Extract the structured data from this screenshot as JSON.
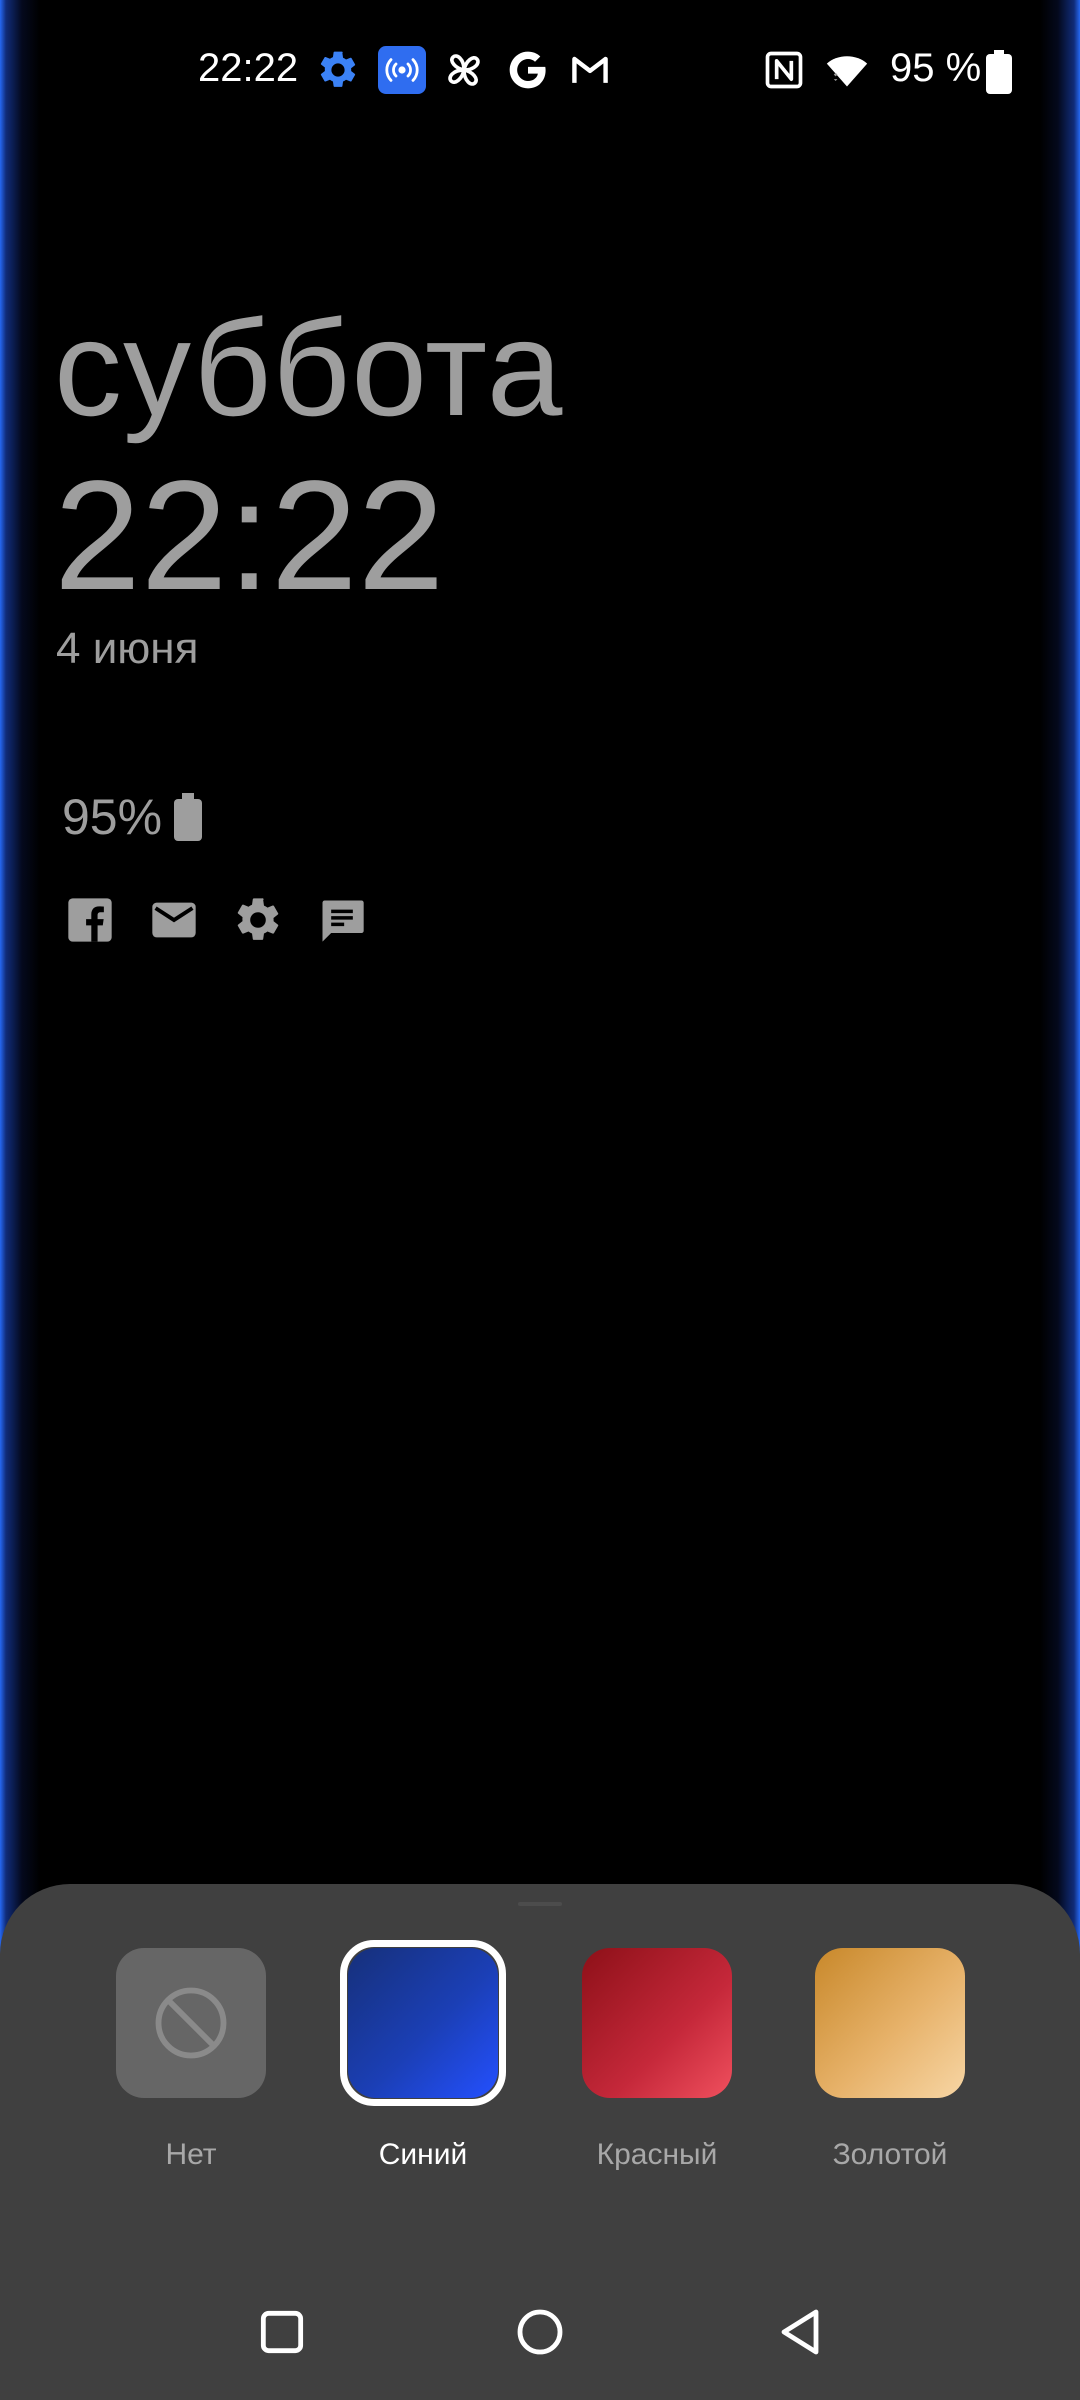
{
  "status_bar": {
    "time": "22:22",
    "battery_percent": "95 %",
    "icons": [
      "settings-icon",
      "hotspot-icon",
      "pinwheel-icon",
      "google-icon",
      "gmail-icon",
      "nfc-icon",
      "wifi-icon",
      "battery-icon"
    ]
  },
  "lock_screen": {
    "day": "суббота",
    "time": "22:22",
    "date": "4 июня",
    "battery": "95%",
    "notification_icons": [
      "facebook-icon",
      "mail-icon",
      "settings-icon",
      "message-icon"
    ]
  },
  "edge_lighting": {
    "color": "#2a64ff"
  },
  "color_picker": {
    "selected": "Синий",
    "options": [
      {
        "label": "Нет",
        "color": "#666666"
      },
      {
        "label": "Синий",
        "color": "#1b3fb6"
      },
      {
        "label": "Красный",
        "color": "#c5283a"
      },
      {
        "label": "Золотой",
        "color": "#e7b26a"
      }
    ]
  },
  "nav_bar": {
    "buttons": [
      "recents-button",
      "home-button",
      "back-button"
    ]
  }
}
